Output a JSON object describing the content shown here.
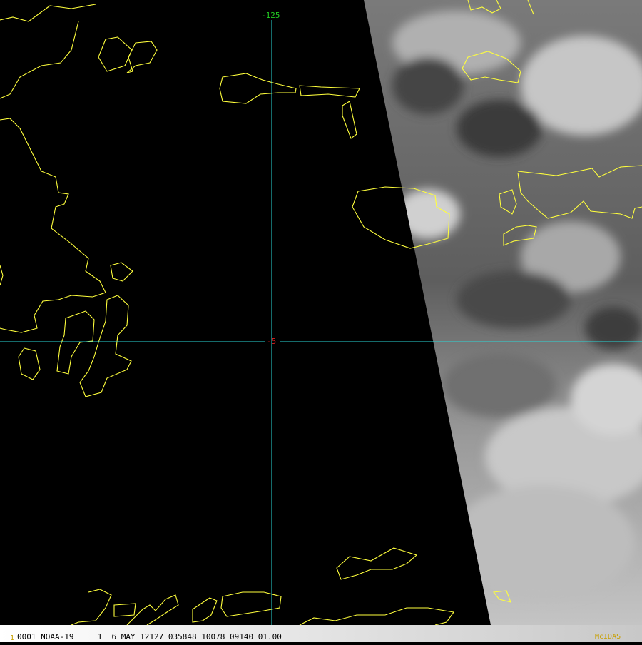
{
  "map": {
    "longitude_label": "-125",
    "latitude_label": "-5",
    "graticule_color": "#2ad6d6",
    "coastline_color": "#ffff3c",
    "longitude_label_color": "#22cc22",
    "latitude_label_color": "#e02020",
    "imagery_type": "grayscale satellite cloud imagery"
  },
  "status_bar": {
    "frame_index": "1",
    "frame_info": "0001 NOAA-19     1  6 MAY 12127 035848 10078 09140 01.00",
    "software": "McIDAS",
    "text_color": "#000000",
    "frame_index_color": "#c8a000",
    "software_color": "#c8a000"
  }
}
